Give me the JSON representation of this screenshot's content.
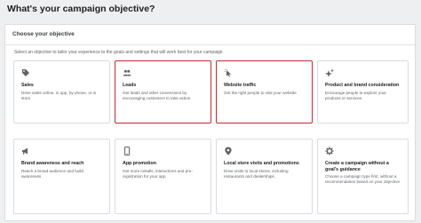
{
  "page": {
    "title": "What's your campaign objective?"
  },
  "panel": {
    "heading": "Choose your objective",
    "instructions": "Select an objective to tailor your experience to the goals and settings that will work best for your campaign"
  },
  "objectives": [
    {
      "icon": "tag-icon",
      "title": "Sales",
      "desc": "Drive sales online, in app, by phone, or in store",
      "selected": false
    },
    {
      "icon": "people-icon",
      "title": "Leads",
      "desc": "Get leads and other conversions by encouraging customers to take action",
      "selected": true
    },
    {
      "icon": "cursor-click-icon",
      "title": "Website traffic",
      "desc": "Get the right people to visit your website",
      "selected": true
    },
    {
      "icon": "sparkle-icon",
      "title": "Product and brand consideration",
      "desc": "Encourage people to explore your products or services",
      "selected": false
    },
    {
      "icon": "megaphone-icon",
      "title": "Brand awareness and reach",
      "desc": "Reach a broad audience and build awareness",
      "selected": false
    },
    {
      "icon": "phone-icon",
      "title": "App promotion",
      "desc": "Get more installs, interactions and pre-registration for your app",
      "selected": false
    },
    {
      "icon": "location-pin-icon",
      "title": "Local store visits and promotions",
      "desc": "Drive visits to local stores, including restaurants and dealerships.",
      "selected": false
    },
    {
      "icon": "gear-icon",
      "title": "Create a campaign without a goal's guidance",
      "desc": "Choose a campaign type first, without a recommendation based on your objective",
      "selected": false
    }
  ],
  "colors": {
    "selected_border": "#c5292f",
    "icon": "#5f6368"
  }
}
